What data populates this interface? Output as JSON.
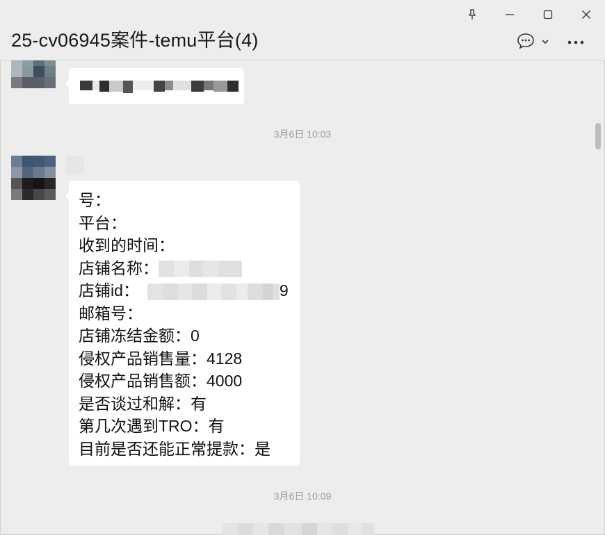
{
  "window": {
    "title": "25-cv06945案件-temu平台(4)",
    "controls": [
      "pin-icon",
      "minimize-icon",
      "maximize-icon",
      "close-icon"
    ]
  },
  "toolbar": {
    "chat_icon": "chat-bubble-icon",
    "dropdown_icon": "chevron-down-icon",
    "more_icon": "more-icon"
  },
  "messages": {
    "timestamp_1": "3月6日 10:03",
    "timestamp_2": "3月6日 10:09",
    "form_lines": [
      "号：",
      "平台：",
      "收到的时间：",
      "店铺名称：",
      "店铺id：",
      "邮箱号：",
      "店铺冻结金额：0",
      "侵权产品销售量：4128",
      "侵权产品销售额：4000",
      "是否谈过和解：有",
      "第几次遇到TRO：有",
      "目前是否还能正常提款：是"
    ],
    "store_id_tail": "9"
  },
  "colors": {
    "background": "#ededed",
    "bubble": "#ffffff",
    "timestamp": "#9a9a9a"
  }
}
